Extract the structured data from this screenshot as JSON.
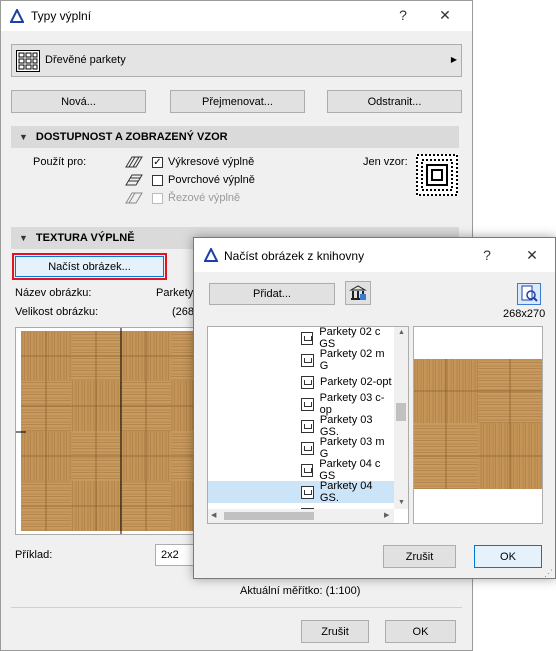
{
  "main_dialog": {
    "title": "Typy výplní",
    "help": "?",
    "close": "✕",
    "fill_name": "Dřevěné parkety",
    "buttons": {
      "new": "Nová...",
      "rename": "Přejmenovat...",
      "delete": "Odstranit..."
    },
    "section_availability": "DOSTUPNOST A ZOBRAZENÝ VZOR",
    "use_for_label": "Použít pro:",
    "options": [
      {
        "label": "Výkresové výplně",
        "checked": "✓"
      },
      {
        "label": "Povrchové výplně",
        "checked": ""
      },
      {
        "label": "Řezové výplně",
        "checked": ""
      }
    ],
    "pattern_only_label": "Jen vzor:",
    "section_texture": "TEXTURA VÝPLNĚ",
    "load_image_button": "Načíst obrázek...",
    "image_name_label": "Název obrázku:",
    "image_name_value": "Parkety",
    "image_size_label": "Velikost obrázku:",
    "image_size_value": "(268",
    "example_label": "Příklad:",
    "example_value": "2x2",
    "current_scale": "Aktuální měřítko: (1:100)",
    "cancel": "Zrušit",
    "ok": "OK"
  },
  "library_dialog": {
    "title": "Načíst obrázek z knihovny",
    "help": "?",
    "close": "✕",
    "add_button": "Přidat...",
    "dimensions": "268x270",
    "files": [
      "Parkety 02 c GS",
      "Parkety 02 m G",
      "Parkety 02-opt",
      "Parkety 03 c-op",
      "Parkety 03 GS.",
      "Parkety 03 m G",
      "Parkety 04 c GS",
      "Parkety 04 GS."
    ],
    "selected_index": 7,
    "cancel": "Zrušit",
    "ok": "OK"
  },
  "colors": {
    "wood_light": "#c99a5e",
    "wood_dark": "#a87a44",
    "selection": "#cce4f7",
    "highlight_border": "#e81123"
  }
}
